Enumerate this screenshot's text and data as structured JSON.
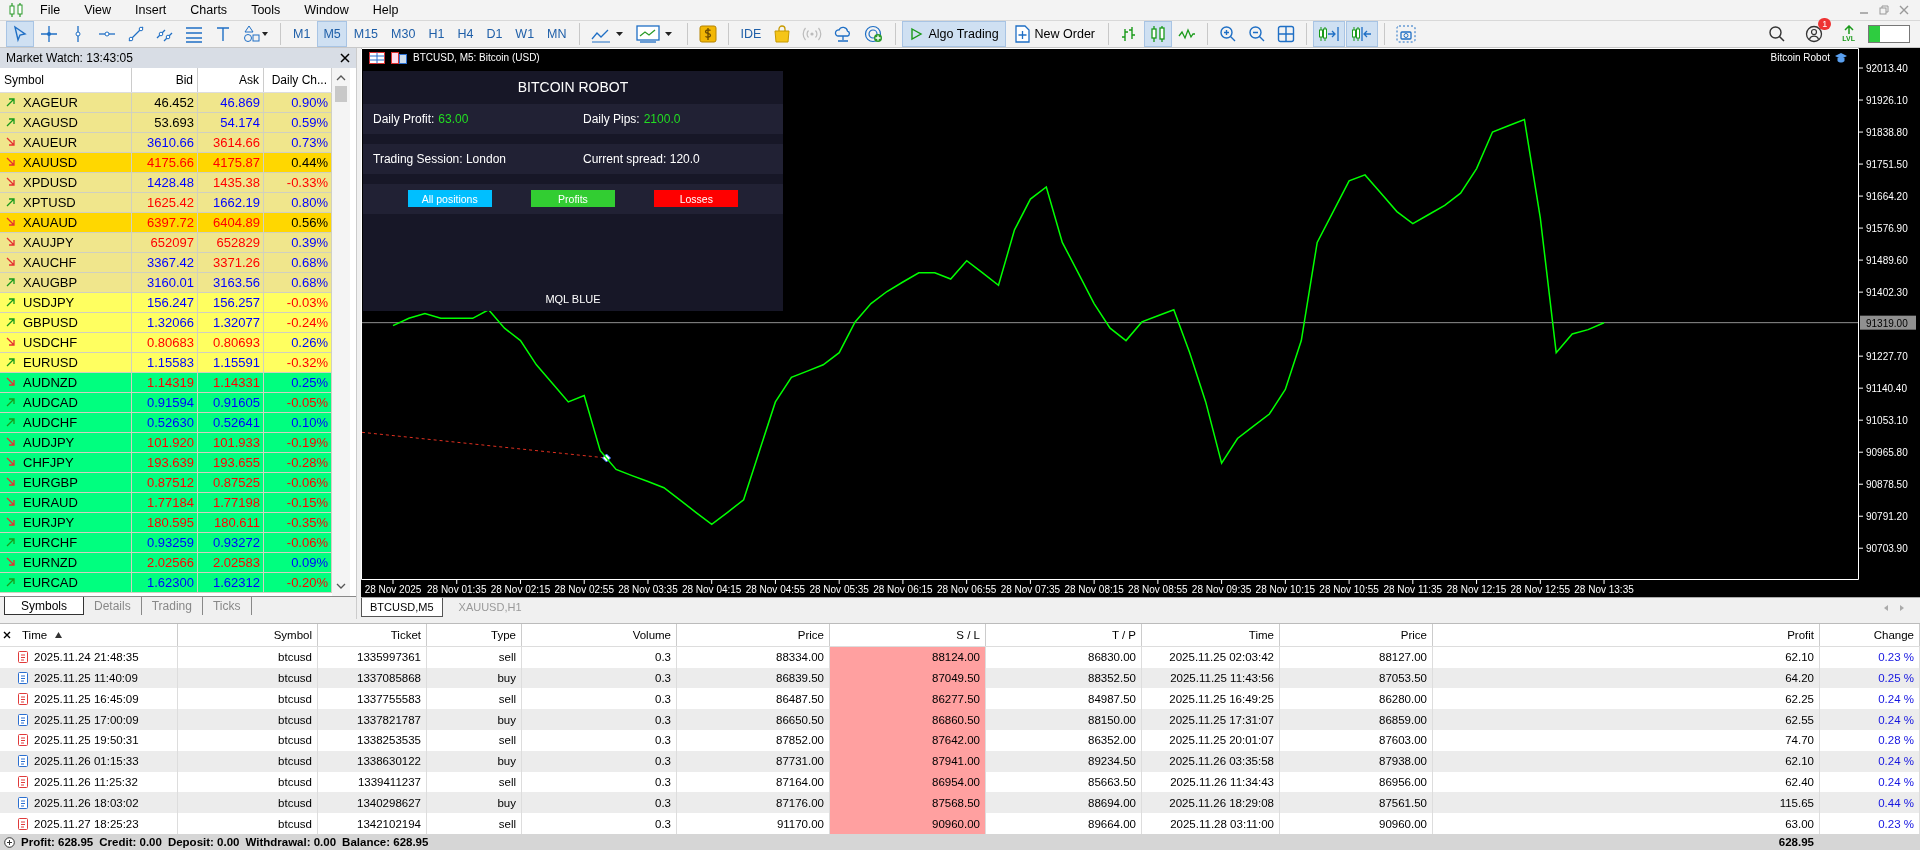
{
  "menu": [
    "File",
    "View",
    "Insert",
    "Charts",
    "Tools",
    "Window",
    "Help"
  ],
  "toolbar": {
    "drawing_tools": [
      {
        "kind": "cursor",
        "selected": true
      },
      {
        "kind": "crosshair",
        "selected": false
      },
      {
        "kind": "vertical-line",
        "selected": false
      },
      {
        "kind": "horizontal-line",
        "selected": false
      },
      {
        "kind": "trendline",
        "selected": false
      },
      {
        "kind": "channel",
        "selected": false
      },
      {
        "kind": "fibonacci",
        "selected": false
      },
      {
        "kind": "text",
        "selected": false
      },
      {
        "kind": "shapes",
        "selected": false
      }
    ],
    "timeframes": [
      {
        "label": "M1",
        "selected": false
      },
      {
        "label": "M5",
        "selected": true
      },
      {
        "label": "M15",
        "selected": false
      },
      {
        "label": "M30",
        "selected": false
      },
      {
        "label": "H1",
        "selected": false
      },
      {
        "label": "H4",
        "selected": false
      },
      {
        "label": "D1",
        "selected": false
      },
      {
        "label": "W1",
        "selected": false
      },
      {
        "label": "MN",
        "selected": false
      }
    ],
    "ide": "IDE",
    "algo_trading": {
      "label": "Algo Trading",
      "on": true
    },
    "new_order": "New Order",
    "chart_modes": [
      {
        "kind": "bars",
        "selected": false
      },
      {
        "kind": "candles",
        "selected": true
      },
      {
        "kind": "line",
        "selected": false
      }
    ],
    "auto_scroll": true,
    "chart_shift": true,
    "notifications": "1",
    "lvl": "LVL"
  },
  "market_watch": {
    "title": "Market Watch: 13:43:05",
    "columns": [
      "Symbol",
      "Bid",
      "Ask",
      "Daily Ch..."
    ],
    "rows": [
      {
        "symbol": "XAGEUR",
        "kind": "up",
        "color": "#f0e68c",
        "bid": {
          "value": "46.452",
          "color": "#000000"
        },
        "ask": {
          "value": "46.869",
          "color": "#0000ff"
        },
        "change": {
          "value": "0.90%",
          "color": "#0000ff"
        }
      },
      {
        "symbol": "XAGUSD",
        "kind": "up",
        "color": "#f0e68c",
        "bid": {
          "value": "53.693",
          "color": "#000000"
        },
        "ask": {
          "value": "54.174",
          "color": "#0000ff"
        },
        "change": {
          "value": "0.59%",
          "color": "#0000ff"
        }
      },
      {
        "symbol": "XAUEUR",
        "kind": "down",
        "color": "#f0e68c",
        "bid": {
          "value": "3610.66",
          "color": "#0000ff"
        },
        "ask": {
          "value": "3614.66",
          "color": "#ff0000"
        },
        "change": {
          "value": "0.73%",
          "color": "#0000ff"
        }
      },
      {
        "symbol": "XAUUSD",
        "kind": "down",
        "color": "#ffd700",
        "bid": {
          "value": "4175.66",
          "color": "#ff0000"
        },
        "ask": {
          "value": "4175.87",
          "color": "#ff0000"
        },
        "change": {
          "value": "0.44%",
          "color": "#000000"
        }
      },
      {
        "symbol": "XPDUSD",
        "kind": "down",
        "color": "#f0e68c",
        "bid": {
          "value": "1428.48",
          "color": "#0000ff"
        },
        "ask": {
          "value": "1435.38",
          "color": "#ff0000"
        },
        "change": {
          "value": "-0.33%",
          "color": "#ff0000"
        }
      },
      {
        "symbol": "XPTUSD",
        "kind": "up",
        "color": "#f0e68c",
        "bid": {
          "value": "1625.42",
          "color": "#ff0000"
        },
        "ask": {
          "value": "1662.19",
          "color": "#0000ff"
        },
        "change": {
          "value": "0.80%",
          "color": "#0000ff"
        }
      },
      {
        "symbol": "XAUAUD",
        "kind": "down",
        "color": "#ffd700",
        "bid": {
          "value": "6397.72",
          "color": "#ff0000"
        },
        "ask": {
          "value": "6404.89",
          "color": "#ff0000"
        },
        "change": {
          "value": "0.56%",
          "color": "#000000"
        }
      },
      {
        "symbol": "XAUJPY",
        "kind": "down",
        "color": "#f0e68c",
        "bid": {
          "value": "652097",
          "color": "#ff0000"
        },
        "ask": {
          "value": "652829",
          "color": "#ff0000"
        },
        "change": {
          "value": "0.39%",
          "color": "#0000ff"
        }
      },
      {
        "symbol": "XAUCHF",
        "kind": "down",
        "color": "#f0e68c",
        "bid": {
          "value": "3367.42",
          "color": "#0000ff"
        },
        "ask": {
          "value": "3371.26",
          "color": "#ff0000"
        },
        "change": {
          "value": "0.68%",
          "color": "#0000ff"
        }
      },
      {
        "symbol": "XAUGBP",
        "kind": "up",
        "color": "#f0e68c",
        "bid": {
          "value": "3160.01",
          "color": "#0000ff"
        },
        "ask": {
          "value": "3163.56",
          "color": "#0000ff"
        },
        "change": {
          "value": "0.68%",
          "color": "#0000ff"
        }
      },
      {
        "symbol": "USDJPY",
        "kind": "up",
        "color": "#ffff60",
        "bid": {
          "value": "156.247",
          "color": "#0000ff"
        },
        "ask": {
          "value": "156.257",
          "color": "#0000ff"
        },
        "change": {
          "value": "-0.03%",
          "color": "#ff0000"
        }
      },
      {
        "symbol": "GBPUSD",
        "kind": "up",
        "color": "#ffff60",
        "bid": {
          "value": "1.32066",
          "color": "#0000ff"
        },
        "ask": {
          "value": "1.32077",
          "color": "#0000ff"
        },
        "change": {
          "value": "-0.24%",
          "color": "#ff0000"
        }
      },
      {
        "symbol": "USDCHF",
        "kind": "down",
        "color": "#ffff60",
        "bid": {
          "value": "0.80683",
          "color": "#ff0000"
        },
        "ask": {
          "value": "0.80693",
          "color": "#ff0000"
        },
        "change": {
          "value": "0.26%",
          "color": "#0000ff"
        }
      },
      {
        "symbol": "EURUSD",
        "kind": "up",
        "color": "#ffff60",
        "bid": {
          "value": "1.15583",
          "color": "#0000ff"
        },
        "ask": {
          "value": "1.15591",
          "color": "#0000ff"
        },
        "change": {
          "value": "-0.32%",
          "color": "#ff0000"
        }
      },
      {
        "symbol": "AUDNZD",
        "kind": "down",
        "color": "#00ff7f",
        "bid": {
          "value": "1.14319",
          "color": "#ff0000"
        },
        "ask": {
          "value": "1.14331",
          "color": "#ff0000"
        },
        "change": {
          "value": "0.25%",
          "color": "#0000ff"
        }
      },
      {
        "symbol": "AUDCAD",
        "kind": "up",
        "color": "#00ff7f",
        "bid": {
          "value": "0.91594",
          "color": "#0000ff"
        },
        "ask": {
          "value": "0.91605",
          "color": "#0000ff"
        },
        "change": {
          "value": "-0.05%",
          "color": "#ff0000"
        }
      },
      {
        "symbol": "AUDCHF",
        "kind": "up",
        "color": "#00ff7f",
        "bid": {
          "value": "0.52630",
          "color": "#0000ff"
        },
        "ask": {
          "value": "0.52641",
          "color": "#0000ff"
        },
        "change": {
          "value": "0.10%",
          "color": "#0000ff"
        }
      },
      {
        "symbol": "AUDJPY",
        "kind": "down",
        "color": "#00ff7f",
        "bid": {
          "value": "101.920",
          "color": "#ff0000"
        },
        "ask": {
          "value": "101.933",
          "color": "#ff0000"
        },
        "change": {
          "value": "-0.19%",
          "color": "#ff0000"
        }
      },
      {
        "symbol": "CHFJPY",
        "kind": "down",
        "color": "#00ff7f",
        "bid": {
          "value": "193.639",
          "color": "#ff0000"
        },
        "ask": {
          "value": "193.655",
          "color": "#ff0000"
        },
        "change": {
          "value": "-0.28%",
          "color": "#ff0000"
        }
      },
      {
        "symbol": "EURGBP",
        "kind": "down",
        "color": "#00ff7f",
        "bid": {
          "value": "0.87512",
          "color": "#ff0000"
        },
        "ask": {
          "value": "0.87525",
          "color": "#ff0000"
        },
        "change": {
          "value": "-0.06%",
          "color": "#ff0000"
        }
      },
      {
        "symbol": "EURAUD",
        "kind": "down",
        "color": "#00ff7f",
        "bid": {
          "value": "1.77184",
          "color": "#ff0000"
        },
        "ask": {
          "value": "1.77198",
          "color": "#ff0000"
        },
        "change": {
          "value": "-0.15%",
          "color": "#ff0000"
        }
      },
      {
        "symbol": "EURJPY",
        "kind": "down",
        "color": "#00ff7f",
        "bid": {
          "value": "180.595",
          "color": "#ff0000"
        },
        "ask": {
          "value": "180.611",
          "color": "#ff0000"
        },
        "change": {
          "value": "-0.35%",
          "color": "#ff0000"
        }
      },
      {
        "symbol": "EURCHF",
        "kind": "up",
        "color": "#00ff7f",
        "bid": {
          "value": "0.93259",
          "color": "#0000ff"
        },
        "ask": {
          "value": "0.93272",
          "color": "#0000ff"
        },
        "change": {
          "value": "-0.06%",
          "color": "#ff0000"
        }
      },
      {
        "symbol": "EURNZD",
        "kind": "down",
        "color": "#00ff7f",
        "bid": {
          "value": "2.02566",
          "color": "#ff0000"
        },
        "ask": {
          "value": "2.02583",
          "color": "#ff0000"
        },
        "change": {
          "value": "0.09%",
          "color": "#0000ff"
        }
      },
      {
        "symbol": "EURCAD",
        "kind": "up",
        "color": "#00ff7f",
        "bid": {
          "value": "1.62300",
          "color": "#0000ff"
        },
        "ask": {
          "value": "1.62312",
          "color": "#0000ff"
        },
        "change": {
          "value": "-0.20%",
          "color": "#ff0000"
        }
      }
    ],
    "tabs": [
      {
        "label": "Symbols",
        "selected": true
      },
      {
        "label": "Details",
        "selected": false
      },
      {
        "label": "Trading",
        "selected": false
      },
      {
        "label": "Ticks",
        "selected": false
      }
    ]
  },
  "chart": {
    "title": "BTCUSD, M5:  Bitcoin (USD)",
    "expert": "Bitcoin Robot",
    "robot_panel": {
      "title": "BITCOIN ROBOT",
      "stats": [
        {
          "label": "Daily Profit:",
          "value": "63.00"
        },
        {
          "label": "Daily Pips:",
          "value": "2100.0"
        },
        {
          "label": "Trading Session: London"
        },
        {
          "label": "Current spread: 120.0"
        }
      ],
      "buttons": [
        {
          "label": "All positions",
          "color": "#00bfff"
        },
        {
          "label": "Profits",
          "color": "#32cd32"
        },
        {
          "label": "Losses",
          "color": "#ff0000"
        }
      ],
      "footer": "MQL BLUE"
    },
    "chart_data": {
      "type": "line",
      "ylim": [
        90620,
        92068
      ],
      "categories": [
        "28 Nov 2025",
        null,
        null,
        null,
        "28 Nov 01:35",
        null,
        null,
        null,
        "28 Nov 02:15",
        null,
        null,
        null,
        "28 Nov 02:55",
        null,
        null,
        null,
        "28 Nov 03:35",
        null,
        null,
        null,
        "28 Nov 04:15",
        null,
        null,
        null,
        "28 Nov 04:55",
        null,
        null,
        null,
        "28 Nov 05:35",
        null,
        null,
        null,
        "28 Nov 06:15",
        null,
        null,
        null,
        "28 Nov 06:55",
        null,
        null,
        null,
        "28 Nov 07:35",
        null,
        null,
        null,
        "28 Nov 08:15",
        null,
        null,
        null,
        "28 Nov 08:55",
        null,
        null,
        null,
        "28 Nov 09:35",
        null,
        null,
        null,
        "28 Nov 10:15",
        null,
        null,
        null,
        "28 Nov 10:55",
        null,
        null,
        null,
        "28 Nov 11:35",
        null,
        null,
        null,
        "28 Nov 12:15",
        null,
        null,
        null,
        "28 Nov 12:55",
        null,
        null,
        null,
        "28 Nov 13:35",
        null,
        null,
        null,
        null,
        null,
        null,
        null,
        null,
        null,
        null,
        null,
        null,
        null,
        null,
        null
      ],
      "series": [
        {
          "color": "#00ff00",
          "values": [
            91311,
            91331,
            91344,
            91331,
            91331,
            91331,
            91354,
            91304,
            91270,
            91204,
            91154,
            91103,
            91120,
            90970,
            90919,
            90902,
            90886,
            90869,
            90836,
            90802,
            90769,
            90802,
            90836,
            90970,
            91103,
            91170,
            91187,
            91204,
            91237,
            91321,
            91371,
            91404,
            91430,
            91455,
            91455,
            91438,
            91488,
            91455,
            91421,
            91572,
            91656,
            91689,
            91538,
            91455,
            91371,
            91304,
            91270,
            91321,
            91338,
            91354,
            91237,
            91103,
            90936,
            91003,
            91037,
            91070,
            91137,
            91270,
            91538,
            91622,
            91706,
            91722,
            91672,
            91622,
            91589,
            91614,
            91639,
            91672,
            91739,
            91839,
            91856,
            91873,
            91605,
            91237,
            91288,
            91300,
            91319,
            null,
            null,
            null,
            null,
            null,
            null,
            null,
            null,
            null,
            null,
            null,
            null,
            null,
            null,
            null
          ]
        }
      ],
      "ref_lines": [
        {
          "axis": "y",
          "value": 91319,
          "label": "91319.00",
          "color": "#909090"
        }
      ],
      "yticks": [
        {
          "value": 92013.4,
          "label": "92013.40"
        },
        {
          "value": 91926.1,
          "label": "91926.10"
        },
        {
          "value": 91838.8,
          "label": "91838.80"
        },
        {
          "value": 91751.5,
          "label": "91751.50"
        },
        {
          "value": 91664.2,
          "label": "91664.20"
        },
        {
          "value": 91576.9,
          "label": "91576.90"
        },
        {
          "value": 91489.6,
          "label": "91489.60"
        },
        {
          "value": 91402.3,
          "label": "91402.30"
        },
        {
          "value": 91227.7,
          "label": "91227.70"
        },
        {
          "value": 91140.4,
          "label": "91140.40"
        },
        {
          "value": 91053.1,
          "label": "91053.10"
        },
        {
          "value": 90965.8,
          "label": "90965.80"
        },
        {
          "value": 90878.5,
          "label": "90878.50"
        },
        {
          "value": 90791.2,
          "label": "90791.20"
        },
        {
          "value": 90703.9,
          "label": "90703.90"
        }
      ]
    },
    "tabs": [
      {
        "label": "BTCUSD,M5",
        "selected": true
      },
      {
        "label": "XAUUSD,H1",
        "selected": false
      }
    ]
  },
  "history": {
    "columns": [
      {
        "label": "Time",
        "sorted": true,
        "highlighted": false
      },
      {
        "label": "Symbol",
        "sorted": false,
        "highlighted": false
      },
      {
        "label": "Ticket",
        "sorted": false,
        "highlighted": false
      },
      {
        "label": "Type",
        "sorted": false,
        "highlighted": false
      },
      {
        "label": "Volume",
        "sorted": false,
        "highlighted": false
      },
      {
        "label": "Price",
        "sorted": false,
        "highlighted": false
      },
      {
        "label": "S / L",
        "sorted": false,
        "highlighted": true
      },
      {
        "label": "T / P",
        "sorted": false,
        "highlighted": false
      },
      {
        "label": "Time",
        "sorted": false,
        "highlighted": false
      },
      {
        "label": "Price",
        "sorted": false,
        "highlighted": false
      },
      {
        "label": "Profit",
        "sorted": false,
        "highlighted": false
      },
      {
        "label": "Change",
        "sorted": false,
        "highlighted": false
      }
    ],
    "rows": [
      {
        "kind": "sell",
        "cells": [
          "2025.11.24 21:48:35",
          "btcusd",
          "1335997361",
          "sell",
          "0.3",
          "88334.00",
          "88124.00",
          "86830.00",
          "2025.11.25 02:03:42",
          "88127.00",
          "62.10",
          "0.23 %"
        ]
      },
      {
        "kind": "buy",
        "cells": [
          "2025.11.25 11:40:09",
          "btcusd",
          "1337085868",
          "buy",
          "0.3",
          "86839.50",
          "87049.50",
          "88352.50",
          "2025.11.25 11:43:56",
          "87053.50",
          "64.20",
          "0.25 %"
        ]
      },
      {
        "kind": "sell",
        "cells": [
          "2025.11.25 16:45:09",
          "btcusd",
          "1337755583",
          "sell",
          "0.3",
          "86487.50",
          "86277.50",
          "84987.50",
          "2025.11.25 16:49:25",
          "86280.00",
          "62.25",
          "0.24 %"
        ]
      },
      {
        "kind": "buy",
        "cells": [
          "2025.11.25 17:00:09",
          "btcusd",
          "1337821787",
          "buy",
          "0.3",
          "86650.50",
          "86860.50",
          "88150.00",
          "2025.11.25 17:31:07",
          "86859.00",
          "62.55",
          "0.24 %"
        ]
      },
      {
        "kind": "sell",
        "cells": [
          "2025.11.25 19:50:31",
          "btcusd",
          "1338253535",
          "sell",
          "0.3",
          "87852.00",
          "87642.00",
          "86352.00",
          "2025.11.25 20:01:07",
          "87603.00",
          "74.70",
          "0.28 %"
        ]
      },
      {
        "kind": "buy",
        "cells": [
          "2025.11.26 01:15:33",
          "btcusd",
          "1338630122",
          "buy",
          "0.3",
          "87731.00",
          "87941.00",
          "89234.50",
          "2025.11.26 03:35:58",
          "87938.00",
          "62.10",
          "0.24 %"
        ]
      },
      {
        "kind": "sell",
        "cells": [
          "2025.11.26 11:25:32",
          "btcusd",
          "1339411237",
          "sell",
          "0.3",
          "87164.00",
          "86954.00",
          "85663.50",
          "2025.11.26 11:34:43",
          "86956.00",
          "62.40",
          "0.24 %"
        ]
      },
      {
        "kind": "buy",
        "cells": [
          "2025.11.26 18:03:02",
          "btcusd",
          "1340298627",
          "buy",
          "0.3",
          "87176.00",
          "87568.50",
          "88694.00",
          "2025.11.26 18:29:08",
          "87561.50",
          "115.65",
          "0.44 %"
        ]
      },
      {
        "kind": "sell",
        "cells": [
          "2025.11.27 18:25:23",
          "btcusd",
          "1342102194",
          "sell",
          "0.3",
          "91170.00",
          "90960.00",
          "89664.00",
          "2025.11.28 03:11:00",
          "90960.00",
          "63.00",
          "0.23 %"
        ]
      }
    ],
    "footer": [
      "Profit: 628.95",
      "Credit: 0.00",
      "Deposit: 0.00",
      "Withdrawal: 0.00",
      "Balance: 628.95"
    ],
    "footer_total": "628.95"
  }
}
